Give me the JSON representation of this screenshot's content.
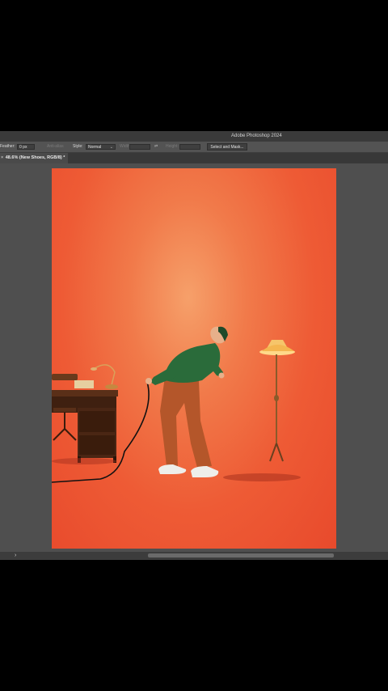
{
  "app": {
    "title": "Adobe Photoshop 2024"
  },
  "options_bar": {
    "feather_label": "Feather:",
    "feather_value": "0 px",
    "anti_alias_label": "Anti-alias",
    "style_label": "Style:",
    "style_value": "Normal",
    "width_label": "Width:",
    "height_label": "Height:",
    "select_mask_label": "Select and Mask..."
  },
  "document_tab": {
    "label": "48.6% (New Shoes, RGB/8) *"
  },
  "statusbar": {
    "arrow": "›"
  },
  "icons": {
    "close_tab": "close-icon",
    "swap": "swap-icon",
    "dropdown": "chevron-down-icon"
  },
  "colors": {
    "artboard_background": "#ee5b35",
    "ui_panel": "#4a4a4a",
    "shirt": "#2a6b3a",
    "pants": "#b85a2a"
  }
}
